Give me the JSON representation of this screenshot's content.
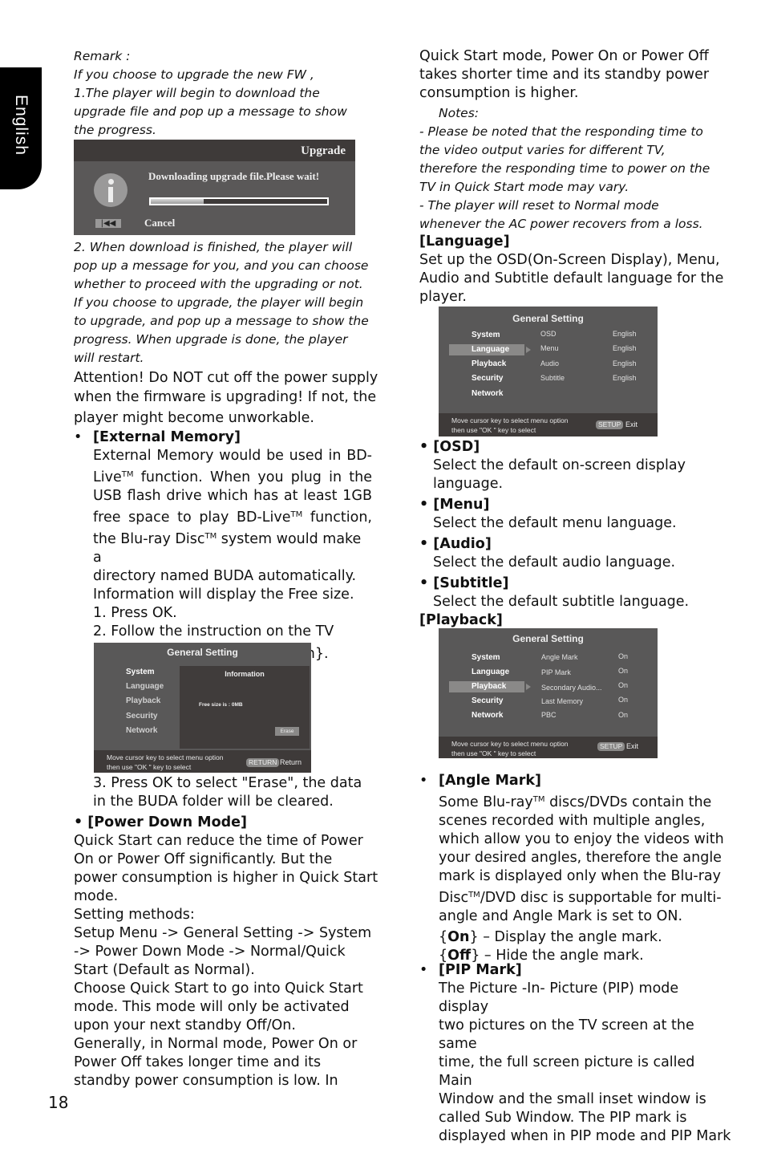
{
  "side_tab": {
    "label": "English"
  },
  "page_number": "18",
  "left": {
    "remark": {
      "heading": "Remark :",
      "lines": [
        "If you choose to upgrade the new FW ,",
        "1.The player will begin to download the",
        "upgrade file and pop up a message to show",
        "the progress."
      ]
    },
    "upgrade_dialog": {
      "title": "Upgrade",
      "message": "Downloading upgrade file.Please wait!",
      "progress_percent": 30,
      "prev_icon": "skip-back-icon",
      "prev_glyph": "|◀◀",
      "cancel_label": "Cancel"
    },
    "step2_lines": [
      "2. When download is finished, the player will",
      "pop up a message for you, and you can choose",
      "whether to proceed with the upgrading or not.",
      "If you choose to upgrade, the player will begin",
      "to upgrade, and pop up a message to show the",
      "progress. When upgrade is done, the player",
      "will restart."
    ],
    "attention_lines": [
      "Attention! Do NOT cut off the power supply",
      "when the firmware is upgrading! If not, the",
      "player might become unworkable."
    ],
    "external_memory": {
      "bullet": "•",
      "heading": "[External Memory]",
      "line1": "External Memory would be used in BD-",
      "line2a": "Live",
      "line2b": " function. When you plug in the",
      "line3": "USB flash drive which has at least 1GB",
      "line4a": "free space to play BD-Live",
      "line4b": " function,",
      "line5a": "the Blu-ray Disc",
      "line5b": " system would make a",
      "line6": "directory named BUDA automatically.",
      "line7": "Information will display the Free size.",
      "tm": "TM",
      "step1": "1. Press OK.",
      "step2a": "2. Follow the instruction on the TV",
      "step2b": "screen to select {Information}.",
      "step3a": "3. Press OK to select \"Erase\", the data",
      "step3b": "in the BUDA folder will be cleared."
    },
    "info_screen": {
      "title": "General Setting",
      "menu": [
        "System",
        "Language",
        "Playback",
        "Security",
        "Network"
      ],
      "panel_title": "Information",
      "free_size": "Free size is : 0MB",
      "erase_label": "Erase",
      "hint_line1": "Move cursor key to select menu option",
      "hint_line2": "then use \"OK \" key to select",
      "key": "RETURN",
      "key_label": "Return"
    },
    "power_down": {
      "heading": "• [Power Down Mode]",
      "lines": [
        "Quick Start can reduce the time of Power",
        "On or Power Off significantly. But the",
        "power consumption is higher in Quick Start",
        "mode.",
        "Setting methods:",
        "Setup Menu -> General Setting -> System",
        "-> Power Down Mode -> Normal/Quick",
        "Start (Default as Normal).",
        "Choose Quick Start to go into Quick Start",
        "mode. This mode will only be activated",
        "upon your next standby Off/On.",
        "Generally, in Normal mode, Power On or",
        "Power Off takes longer time and its",
        "standby power consumption is low. In"
      ]
    }
  },
  "right": {
    "continued_lines": [
      "Quick Start mode, Power On or Power Off",
      "takes shorter time and its standby power",
      "consumption is higher."
    ],
    "notes": {
      "heading": "Notes:",
      "lines": [
        "- Please be noted that the responding time to",
        "the video output varies for different TV,",
        "therefore the responding time to power on the",
        "TV in Quick Start mode may vary.",
        "- The player will reset to Normal mode",
        "whenever the AC power recovers from a loss."
      ]
    },
    "language": {
      "heading": "[Language]",
      "lines": [
        "Set up the OSD(On-Screen Display), Menu,",
        "Audio and Subtitle default language for the",
        "player."
      ]
    },
    "language_screen": {
      "title": "General Setting",
      "menu": [
        "System",
        "Language",
        "Playback",
        "Security",
        "Network"
      ],
      "selected": "Language",
      "options": [
        {
          "label": "OSD",
          "value": "English"
        },
        {
          "label": "Menu",
          "value": "English"
        },
        {
          "label": "Audio",
          "value": "English"
        },
        {
          "label": "Subtitle",
          "value": "English"
        }
      ],
      "hint_line1": "Move cursor key to select menu option",
      "hint_line2": "then use \"OK \" key to select",
      "key": "SETUP",
      "key_label": "Exit"
    },
    "language_items": [
      {
        "heading": "• [OSD]",
        "lines": [
          "Select the default on-screen display",
          "language."
        ]
      },
      {
        "heading": "• [Menu]",
        "lines": [
          "Select the default menu language."
        ]
      },
      {
        "heading": "• [Audio]",
        "lines": [
          "Select the default audio language."
        ]
      },
      {
        "heading": "• [Subtitle]",
        "lines": [
          "Select the default subtitle language."
        ]
      }
    ],
    "playback_heading": "[Playback]",
    "playback_screen": {
      "title": "General Setting",
      "menu": [
        "System",
        "Language",
        "Playback",
        "Security",
        "Network"
      ],
      "selected": "Playback",
      "options": [
        {
          "label": "Angle Mark",
          "value": "On"
        },
        {
          "label": "PIP Mark",
          "value": "On"
        },
        {
          "label": "Secondary Audio...",
          "value": "On"
        },
        {
          "label": "Last Memory",
          "value": "On"
        },
        {
          "label": "PBC",
          "value": "On"
        }
      ],
      "hint_line1": "Move cursor key to select menu option",
      "hint_line2": "then use \"OK \" key to select",
      "key": "SETUP",
      "key_label": "Exit"
    },
    "angle_mark": {
      "bullet": "•",
      "heading": "[Angle Mark]",
      "line1a": "Some Blu-ray",
      "line1b": " discs/DVDs contain the",
      "tm": "TM",
      "lines": [
        "scenes recorded with multiple angles,",
        "which allow you to enjoy the videos with",
        "your desired angles, therefore the angle",
        "mark is displayed only when the Blu-ray"
      ],
      "line6a": "Disc",
      "line6b": "/DVD disc is supportable for multi-",
      "line7": "angle and Angle Mark is set to ON.",
      "on_key": "On",
      "on_desc": " – Display the angle mark.",
      "off_key": "Off",
      "off_desc": " – Hide the angle mark."
    },
    "pip_mark": {
      "bullet": "•",
      "heading": "[PIP Mark]",
      "lines": [
        "The Picture -In- Picture (PIP) mode display",
        "two pictures on the TV screen at the same",
        "time, the full screen picture is called Main",
        "Window and the small inset window is",
        "called Sub Window. The PIP mark is",
        "displayed when in PIP mode and PIP Mark"
      ]
    }
  }
}
